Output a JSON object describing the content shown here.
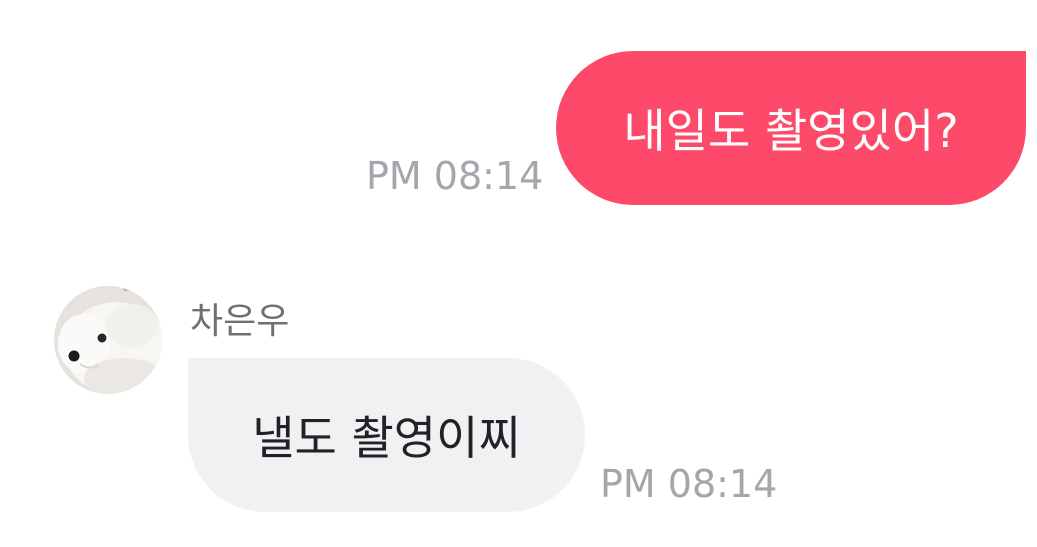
{
  "messages": [
    {
      "direction": "outgoing",
      "text": "내일도 촬영있어?",
      "time": "PM 08:14"
    },
    {
      "direction": "incoming",
      "sender": "차은우",
      "avatar_icon": "white-dog-avatar",
      "text": "낼도 촬영이찌",
      "time": "PM 08:14"
    }
  ],
  "colors": {
    "outgoing_bubble": "#fd4a6a",
    "outgoing_text": "#ffffff",
    "incoming_bubble": "#f1f1f3",
    "incoming_text": "#222226",
    "timestamp": "#a5a5ab",
    "sender_name": "#6f6f75",
    "background": "#ffffff"
  }
}
